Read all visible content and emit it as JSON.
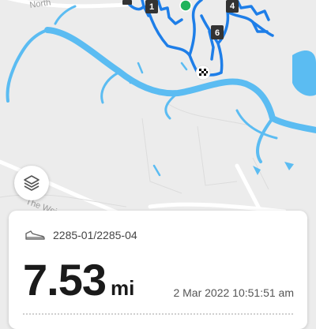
{
  "map": {
    "road_label_top": "North",
    "road_label_left": "The Wei",
    "lap_markers": [
      "1",
      "4",
      "6"
    ]
  },
  "layers_button": {
    "icon": "layers-icon"
  },
  "activity": {
    "shoe_icon": "shoe-icon",
    "shoe_name": "2285-01/2285-04",
    "distance_value": "7.53",
    "distance_unit": "mi",
    "datetime": "2 Mar 2022 10:51:51 am"
  },
  "colors": {
    "route": "#1e7ee8",
    "water": "#5bbcf2",
    "start_marker": "#1fb35b",
    "lap_marker": "#333333"
  }
}
